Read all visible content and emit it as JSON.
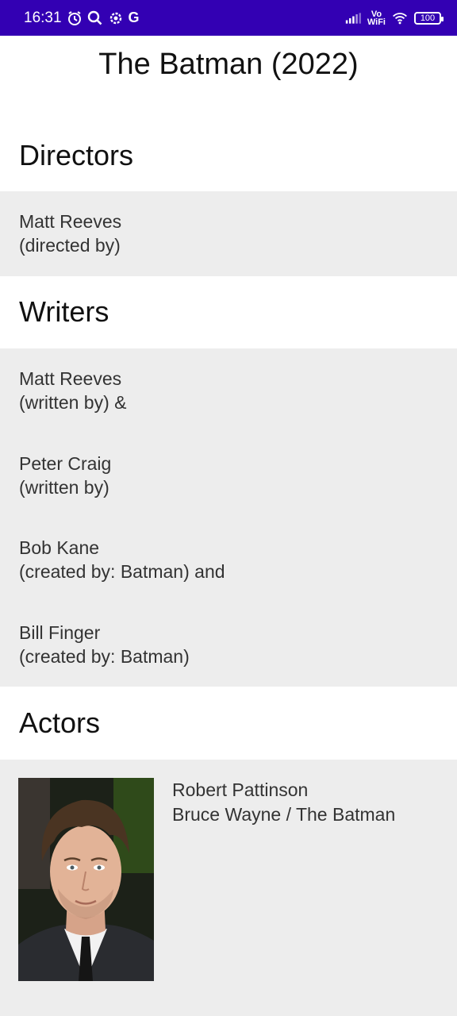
{
  "status_bar": {
    "time": "16:31",
    "left_icons": [
      "alarm-icon",
      "search-icon",
      "settings-icon"
    ],
    "g_label": "G",
    "vowifi_line1": "Vo",
    "vowifi_line2": "WiFi",
    "battery": "100",
    "background": "#3300b3"
  },
  "page": {
    "title": "The Batman (2022)"
  },
  "directors": {
    "heading": "Directors",
    "items": [
      {
        "name": "Matt Reeves",
        "credit": "(directed by)"
      }
    ]
  },
  "writers": {
    "heading": "Writers",
    "items": [
      {
        "name": "Matt Reeves",
        "credit": "(written by) &"
      },
      {
        "name": "Peter Craig",
        "credit": "(written by)"
      },
      {
        "name": "Bob Kane",
        "credit": "(created by: Batman) and"
      },
      {
        "name": "Bill Finger",
        "credit": "(created by: Batman)"
      }
    ]
  },
  "actors": {
    "heading": "Actors",
    "items": [
      {
        "name": "Robert Pattinson",
        "role": "Bruce Wayne / The Batman"
      }
    ]
  },
  "colors": {
    "band": "#ededed",
    "text": "#333333"
  }
}
